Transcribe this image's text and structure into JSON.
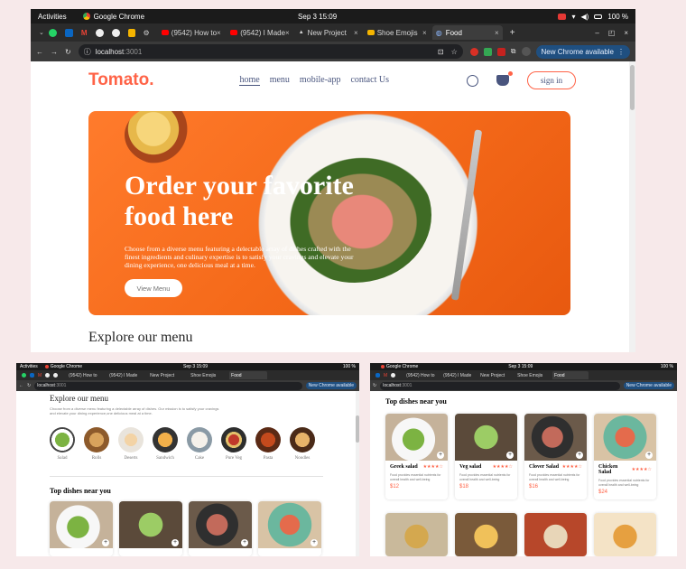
{
  "colors": {
    "brand": "#ff6347",
    "nav_text": "#49557e",
    "os_bar": "#1b1b1b",
    "chrome_update": "#1a73e8"
  },
  "os": {
    "activities": "Activities",
    "app": "Google Chrome",
    "clock": "Sep 3  15:09",
    "battery": "100 %"
  },
  "tabs": [
    {
      "label": "(9542) How to",
      "icon": "youtube-icon"
    },
    {
      "label": "(9542) I Made",
      "icon": "youtube-icon"
    },
    {
      "label": "New Project",
      "icon": "triangle-icon"
    },
    {
      "label": "Shoe Emojis",
      "icon": "folder-icon"
    },
    {
      "label": "Food",
      "icon": "globe-icon"
    }
  ],
  "address": {
    "host": "localhost",
    "port": ":3001",
    "update_label": "New Chrome available"
  },
  "site": {
    "logo": "Tomato.",
    "menu": [
      "home",
      "menu",
      "mobile-app",
      "contact Us"
    ],
    "signin": "sign in",
    "hero_title_1": "Order your favorite",
    "hero_title_2": "food here",
    "hero_text": "Choose from a diverse menu featuring a delectable array of dishes crafted with the finest ingredients and culinary expertise is to satisfy your cravings and elevate your dining experience, one delicious meal at a time.",
    "view_menu": "View Menu",
    "explore_title": "Explore our menu",
    "explore_text": "Choose from a diverse menu featuring a delectable array of dishes. Our mission is to satisfy your cravings and elevate your dining experience,one delicious meal at a time.",
    "categories": [
      "Salad",
      "Rolls",
      "Deserts",
      "Sandwich",
      "Cake",
      "Pure Veg",
      "Pasta",
      "Noodles"
    ],
    "top_dishes_title": "Top dishes near you",
    "dishes": [
      {
        "name": "Greek salad",
        "stars": "★★★★☆",
        "desc": "Food provides essential nutrients for overall health and well-being",
        "price": "$12"
      },
      {
        "name": "Veg salad",
        "stars": "★★★★☆",
        "desc": "Food provides essential nutrients for overall health and well-being",
        "price": "$18"
      },
      {
        "name": "Clover Salad",
        "stars": "★★★★☆",
        "desc": "Food provides essential nutrients for overall health and well-being",
        "price": "$16"
      },
      {
        "name": "Chicken Salad",
        "stars": "★★★★☆",
        "desc": "Food provides essential nutrients for overall health and well-being",
        "price": "$24"
      }
    ]
  }
}
